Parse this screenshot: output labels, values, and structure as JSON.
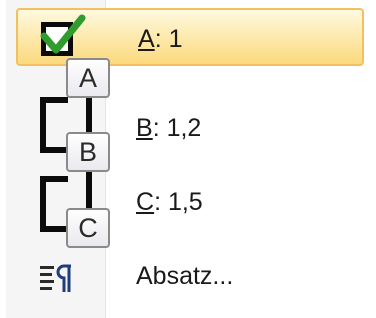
{
  "menu": {
    "items": [
      {
        "accel": "A",
        "rest": ": 1",
        "keytip": "A",
        "selected": true
      },
      {
        "accel": "B",
        "rest": ": 1,2",
        "keytip": "B",
        "selected": false
      },
      {
        "accel": "C",
        "rest": ": 1,5",
        "keytip": "C",
        "selected": false
      }
    ],
    "paragraph_label": "Absatz..."
  },
  "colors": {
    "highlight_border": "#f2c060",
    "highlight_fill": "#fde8a8",
    "check": "#2e9c2e",
    "keytip_border": "#8a8a8a"
  },
  "icons": {
    "checkbox": "checkbox-checked-icon",
    "line_spacing": "line-spacing-icon",
    "paragraph": "paragraph-icon"
  }
}
